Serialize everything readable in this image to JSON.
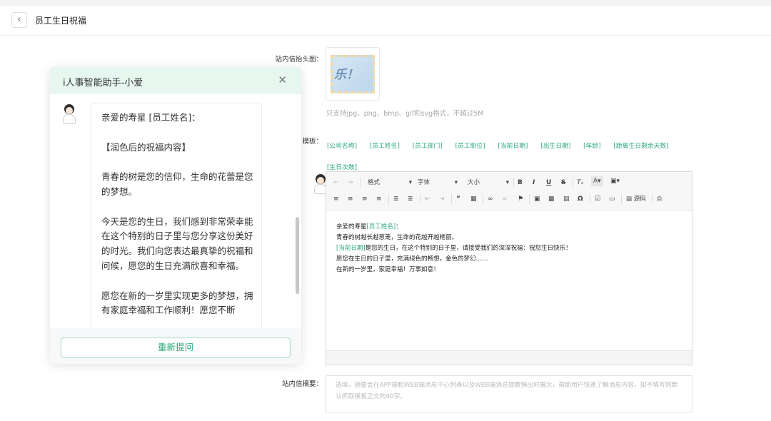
{
  "header": {
    "title": "员工生日祝福",
    "back_icon": "chevron-left-icon"
  },
  "form": {
    "head_image_label": "站内信抬头图：",
    "image_text": "乐！",
    "upload_hint": "只支持jpg、png、bmp、gif和svg格式，不超过5M",
    "template_label": "模板：",
    "tags": [
      "[公司名称]",
      "[员工姓名]",
      "[员工部门]",
      "[员工职位]",
      "[当前日期]",
      "[出生日期]",
      "[年龄]",
      "[距离生日剩余天数]",
      "[生日次数]"
    ],
    "summary_label": "站内信摘要：",
    "summary_placeholder": "选填，摘要会在APP端和WEB端消息中心列表以及WEB端消息提醒弹出时展示，帮助用户快速了解消息内容。如不填写则默认抓取模板正文的40字。"
  },
  "editor": {
    "toolbar": {
      "format": "格式",
      "font": "字体",
      "size": "大小",
      "bold": "B",
      "italic": "I",
      "underline": "U",
      "strike": "S",
      "source": "源码"
    },
    "content": {
      "line1_prefix": "亲爱的寿星",
      "line1_tag": "[员工姓名]",
      "line1_suffix": "：",
      "line2": "青春的树越长越葱茏，生命的花越开越艳丽。",
      "line3_tag": "[当前日期]",
      "line3_text": "是您的生日，在这个特别的日子里，请接受我们的深深祝福：祝您生日快乐！",
      "line4": "愿您在生日的日子里，充满绿色的畅想，金色的梦幻……",
      "line5": "在新的一岁里，家庭幸福！万事如意！"
    }
  },
  "assistant": {
    "title": "i人事智能助手-小爱",
    "close_icon": "close-icon",
    "paragraphs": [
      "亲爱的寿星 [员工姓名]：",
      "【润色后的祝福内容】",
      "青春的树是您的信仰，生命的花蕾是您的梦想。",
      "今天是您的生日，我们感到非常荣幸能在这个特别的日子里与您分享这份美好的时光。我们向您表达最真挚的祝福和问候，愿您的生日充满欣喜和幸福。",
      "愿您在新的一岁里实现更多的梦想，拥有家庭幸福和工作顺利！愿您不断"
    ],
    "reask_label": "重新提问"
  },
  "colors": {
    "accent": "#2aa876",
    "header_bg": "#e8f6f0"
  }
}
